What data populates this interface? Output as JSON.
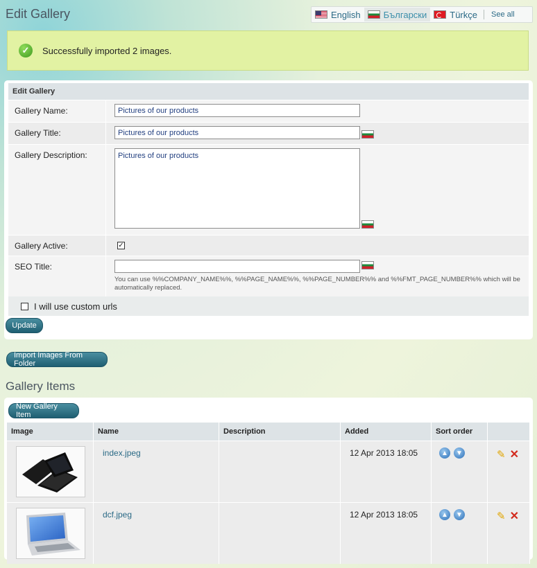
{
  "page": {
    "title": "Edit Gallery"
  },
  "languages": {
    "items": [
      {
        "label": "English",
        "flag": "us-flag-icon"
      },
      {
        "label": "Български",
        "flag": "bg-flag-icon",
        "active": true
      },
      {
        "label": "Türkçe",
        "flag": "tr-flag-icon"
      }
    ],
    "see_all": "See all"
  },
  "message": {
    "text": "Successfully imported 2 images.",
    "icon": "success-check-icon",
    "color": "#e2f2a3"
  },
  "form": {
    "header": "Edit Gallery",
    "name_label": "Gallery Name:",
    "name_value": "Pictures of our products",
    "title_label": "Gallery Title:",
    "title_value": "Pictures of our products",
    "description_label": "Gallery Description:",
    "description_value": "Pictures of our products",
    "active_label": "Gallery Active:",
    "active_checked": true,
    "seo_label": "SEO Title:",
    "seo_value": "",
    "seo_hint": "You can use %%COMPANY_NAME%%, %%PAGE_NAME%%, %%PAGE_NUMBER%% and %%FMT_PAGE_NUMBER%% which will be automatically replaced.",
    "custom_urls_label": "I will use custom urls",
    "custom_urls_checked": false,
    "update_button": "Update"
  },
  "import_button": "Import Images From Folder",
  "gallery_items": {
    "title": "Gallery Items",
    "new_button": "New Gallery Item",
    "columns": [
      "Image",
      "Name",
      "Description",
      "Added",
      "Sort order"
    ],
    "rows": [
      {
        "name": "index.jpeg",
        "description": "",
        "added": "12 Apr 2013 18:05"
      },
      {
        "name": "dcf.jpeg",
        "description": "",
        "added": "12 Apr 2013 18:05"
      }
    ]
  },
  "colors": {
    "accent": "#2b6a86",
    "button": "#1f5f72",
    "header_bg": "#dde3e6"
  }
}
